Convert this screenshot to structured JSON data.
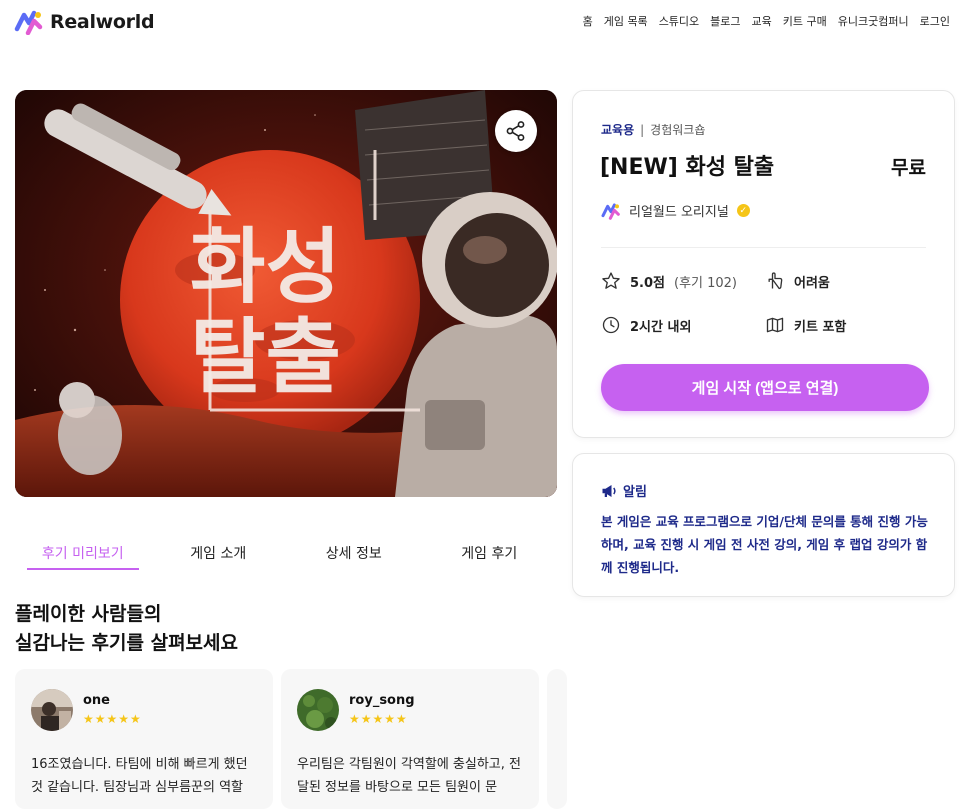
{
  "brand": {
    "name": "Realworld",
    "accent": "#c661f0",
    "navy": "#1e2a8a"
  },
  "nav": {
    "items": [
      "홈",
      "게임 목록",
      "스튜디오",
      "블로그",
      "교육",
      "키트 구매",
      "유니크굿컴퍼니",
      "로그인"
    ]
  },
  "hero": {
    "title_line1": "화성",
    "title_line2": "탈출",
    "share_icon": "share-icon"
  },
  "tabs": [
    "후기 미리보기",
    "게임 소개",
    "상세 정보",
    "게임 후기"
  ],
  "section": {
    "title_line1": "플레이한 사람들의",
    "title_line2": "실감나는 후기를 살펴보세요"
  },
  "reviews": [
    {
      "name": "one",
      "stars": "★★★★★",
      "text": "16조였습니다. 타팀에 비해 빠르게 했던 것 같습니다. 팀장님과 심부름꾼의 역할"
    },
    {
      "name": "roy_song",
      "stars": "★★★★★",
      "text": "우리팀은 각팀원이 각역할에 충실하고, 전달된 정보를 바탕으로 모든 팀원이 문"
    }
  ],
  "info": {
    "category_primary": "교육용",
    "category_separator": "|",
    "category_secondary": "경험워크숍",
    "title": "[NEW] 화성 탈출",
    "price": "무료",
    "creator": "리얼월드 오리지널",
    "rating": "5.0점",
    "review_count": "(후기 102)",
    "difficulty": "어려움",
    "duration": "2시간 내외",
    "kit": "키트 포함",
    "play_button": "게임 시작 (앱으로 연결)"
  },
  "notice": {
    "title": "알림",
    "text": "본 게임은 교육 프로그램으로 기업/단체 문의를 통해 진행 가능하며, 교육 진행 시 게임 전 사전 강의, 게임 후 랩업 강의가 함께 진행됩니다."
  }
}
